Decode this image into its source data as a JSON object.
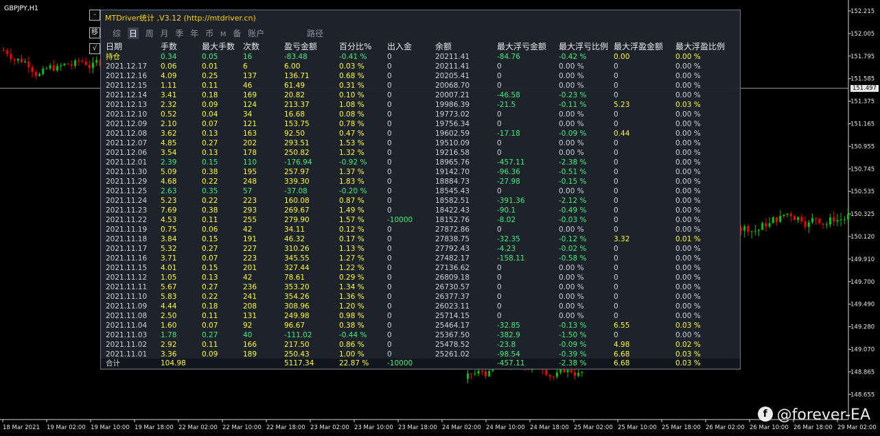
{
  "chart": {
    "symbol": "GBPJPY,H1",
    "current_price": "151.497",
    "price_ticks": [
      "152.215",
      "152.005",
      "151.795",
      "151.585",
      "151.375",
      "151.165",
      "150.955",
      "150.745",
      "150.535",
      "150.325",
      "150.120",
      "149.910",
      "149.700",
      "149.490",
      "149.280",
      "149.070",
      "148.865",
      "148.655"
    ],
    "time_ticks": [
      "18 Mar 2021",
      "19 Mar 02:00",
      "19 Mar 10:00",
      "19 Mar 18:00",
      "22 Mar 02:00",
      "22 Mar 10:00",
      "22 Mar 18:00",
      "23 Mar 02:00",
      "23 Mar 10:00",
      "23 Mar 18:00",
      "24 Mar 02:00",
      "24 Mar 10:00",
      "24 Mar 18:00",
      "25 Mar 02:00",
      "25 Mar 10:00",
      "25 Mar 18:00",
      "26 Mar 02:00",
      "26 Mar 10:00",
      "26 Mar 18:00",
      "29 Mar 02:00"
    ],
    "colors": {
      "up": "#00c800",
      "down": "#ff0000",
      "background": "#000000"
    }
  },
  "watermark": "@forever-EA",
  "side_buttons": [
    "-",
    "移",
    "√"
  ],
  "panel": {
    "title": "MTDriver统计 ,V3.12 (http://mtdriver.cn)",
    "tabs": [
      "综",
      "日",
      "周",
      "月",
      "季",
      "年",
      "币",
      "M",
      "备",
      "账户"
    ],
    "tab_path": "路径",
    "headers": [
      "日期",
      "手数",
      "最大手数",
      "次数",
      "盈亏金额",
      "百分比%",
      "出入金",
      "余额",
      "最大浮亏金额",
      "最大浮亏比例",
      "最大浮盈金额",
      "最大浮盈比例"
    ],
    "rows": [
      {
        "c": [
          "持仓",
          "0.34",
          "0.05",
          "16",
          "-83.48",
          "-0.41 %",
          "0",
          "20211.41",
          "-84.76",
          "-0.42 %",
          "0.00",
          "0.00 %"
        ],
        "color": "g"
      },
      {
        "c": [
          "2021.12.17",
          "0.06",
          "0.01",
          "6",
          "6.00",
          "0.03 %",
          "0",
          "20211.41",
          "0",
          "0.00 %",
          "0",
          "0.00 %"
        ],
        "color": "y"
      },
      {
        "c": [
          "2021.12.16",
          "4.09",
          "0.25",
          "137",
          "136.71",
          "0.68 %",
          "0",
          "20205.41",
          "0",
          "0.00 %",
          "0",
          "0.00 %"
        ],
        "color": "y"
      },
      {
        "c": [
          "2021.12.15",
          "1.11",
          "0.11",
          "46",
          "61.49",
          "0.31 %",
          "0",
          "20068.70",
          "0",
          "0.00 %",
          "0",
          "0.00 %"
        ],
        "color": "y"
      },
      {
        "c": [
          "2021.12.14",
          "3.41",
          "0.18",
          "169",
          "20.82",
          "0.10 %",
          "0",
          "20007.21",
          "-46.58",
          "-0.23 %",
          "0",
          "0.00 %"
        ],
        "color": "y"
      },
      {
        "c": [
          "2021.12.13",
          "2.32",
          "0.09",
          "124",
          "213.37",
          "1.08 %",
          "0",
          "19986.39",
          "-21.5",
          "-0.11 %",
          "5.23",
          "0.03 %"
        ],
        "color": "y"
      },
      {
        "c": [
          "2021.12.10",
          "0.52",
          "0.04",
          "34",
          "16.68",
          "0.08 %",
          "0",
          "19773.02",
          "0",
          "0.00 %",
          "0",
          "0.00 %"
        ],
        "color": "y"
      },
      {
        "c": [
          "2021.12.09",
          "2.10",
          "0.07",
          "121",
          "153.75",
          "0.78 %",
          "0",
          "19756.34",
          "0",
          "0.00 %",
          "0",
          "0.00 %"
        ],
        "color": "y"
      },
      {
        "c": [
          "2021.12.08",
          "3.62",
          "0.13",
          "163",
          "92.50",
          "0.47 %",
          "0",
          "19602.59",
          "-17.18",
          "-0.09 %",
          "0.44",
          "0.00 %"
        ],
        "color": "y"
      },
      {
        "c": [
          "2021.12.07",
          "4.85",
          "0.27",
          "202",
          "293.51",
          "1.53 %",
          "0",
          "19510.09",
          "0",
          "0.00 %",
          "0",
          "0.00 %"
        ],
        "color": "y"
      },
      {
        "c": [
          "2021.12.06",
          "3.54",
          "0.13",
          "178",
          "250.82",
          "1.32 %",
          "0",
          "19216.58",
          "0",
          "0.00 %",
          "0",
          "0.00 %"
        ],
        "color": "y"
      },
      {
        "c": [
          "2021.12.01",
          "2.39",
          "0.15",
          "110",
          "-176.94",
          "-0.92 %",
          "0",
          "18965.76",
          "-457.11",
          "-2.38 %",
          "0",
          "0.00 %"
        ],
        "color": "g"
      },
      {
        "c": [
          "2021.11.30",
          "5.09",
          "0.38",
          "195",
          "257.97",
          "1.37 %",
          "0",
          "19142.70",
          "-96.36",
          "-0.51 %",
          "0",
          "0.00 %"
        ],
        "color": "y"
      },
      {
        "c": [
          "2021.11.29",
          "4.68",
          "0.22",
          "248",
          "339.30",
          "1.83 %",
          "0",
          "18884.73",
          "-27.98",
          "-0.15 %",
          "0",
          "0.00 %"
        ],
        "color": "y"
      },
      {
        "c": [
          "2021.11.25",
          "2.63",
          "0.35",
          "57",
          "-37.08",
          "-0.20 %",
          "0",
          "18545.43",
          "0",
          "0.00 %",
          "0",
          "0.00 %"
        ],
        "color": "g"
      },
      {
        "c": [
          "2021.11.24",
          "5.23",
          "0.22",
          "223",
          "160.08",
          "0.87 %",
          "0",
          "18582.51",
          "-391.36",
          "-2.12 %",
          "0",
          "0.00 %"
        ],
        "color": "y"
      },
      {
        "c": [
          "2021.11.23",
          "7.69",
          "0.38",
          "293",
          "269.67",
          "1.49 %",
          "0",
          "18422.43",
          "-90.1",
          "-0.49 %",
          "0",
          "0.00 %"
        ],
        "color": "y"
      },
      {
        "c": [
          "2021.11.22",
          "4.53",
          "0.11",
          "255",
          "279.90",
          "1.57 %",
          "-10000",
          "18152.76",
          "-8.02",
          "-0.03 %",
          "0",
          "0.00 %"
        ],
        "color": "y"
      },
      {
        "c": [
          "2021.11.19",
          "0.75",
          "0.06",
          "42",
          "34.11",
          "0.12 %",
          "0",
          "27872.86",
          "0",
          "0.00 %",
          "0",
          "0.00 %"
        ],
        "color": "y"
      },
      {
        "c": [
          "2021.11.18",
          "3.84",
          "0.15",
          "191",
          "46.32",
          "0.17 %",
          "0",
          "27838.75",
          "-32.35",
          "-0.12 %",
          "3.32",
          "0.01 %"
        ],
        "color": "y"
      },
      {
        "c": [
          "2021.11.17",
          "5.32",
          "0.27",
          "227",
          "310.26",
          "1.13 %",
          "0",
          "27792.43",
          "-4.23",
          "-0.02 %",
          "0",
          "0.00 %"
        ],
        "color": "y"
      },
      {
        "c": [
          "2021.11.16",
          "3.71",
          "0.07",
          "223",
          "345.55",
          "1.27 %",
          "0",
          "27482.17",
          "-158.11",
          "-0.58 %",
          "0",
          "0.00 %"
        ],
        "color": "y"
      },
      {
        "c": [
          "2021.11.15",
          "4.01",
          "0.15",
          "201",
          "327.44",
          "1.22 %",
          "0",
          "27136.62",
          "0",
          "0.00 %",
          "0",
          "0.00 %"
        ],
        "color": "y"
      },
      {
        "c": [
          "2021.11.12",
          "1.05",
          "0.13",
          "42",
          "78.61",
          "0.29 %",
          "0",
          "26809.18",
          "0",
          "0.00 %",
          "0",
          "0.00 %"
        ],
        "color": "y"
      },
      {
        "c": [
          "2021.11.11",
          "5.67",
          "0.27",
          "236",
          "353.20",
          "1.34 %",
          "0",
          "26730.57",
          "0",
          "0.00 %",
          "0",
          "0.00 %"
        ],
        "color": "y"
      },
      {
        "c": [
          "2021.11.10",
          "5.83",
          "0.22",
          "241",
          "354.26",
          "1.36 %",
          "0",
          "26377.37",
          "0",
          "0.00 %",
          "0",
          "0.00 %"
        ],
        "color": "y"
      },
      {
        "c": [
          "2021.11.09",
          "4.44",
          "0.18",
          "208",
          "308.96",
          "1.20 %",
          "0",
          "26023.11",
          "0",
          "0.00 %",
          "0",
          "0.00 %"
        ],
        "color": "y"
      },
      {
        "c": [
          "2021.11.08",
          "2.50",
          "0.11",
          "131",
          "249.98",
          "0.98 %",
          "0",
          "25714.15",
          "0",
          "0.00 %",
          "0",
          "0.00 %"
        ],
        "color": "y"
      },
      {
        "c": [
          "2021.11.04",
          "1.60",
          "0.07",
          "92",
          "96.67",
          "0.38 %",
          "0",
          "25464.17",
          "-32.85",
          "-0.13 %",
          "6.55",
          "0.03 %"
        ],
        "color": "y"
      },
      {
        "c": [
          "2021.11.03",
          "1.78",
          "0.27",
          "40",
          "-111.02",
          "-0.44 %",
          "0",
          "25367.50",
          "-382.9",
          "-1.50 %",
          "0",
          "0.00 %"
        ],
        "color": "g"
      },
      {
        "c": [
          "2021.11.02",
          "2.92",
          "0.11",
          "166",
          "217.50",
          "0.86 %",
          "0",
          "25478.52",
          "-23.8",
          "-0.09 %",
          "4.98",
          "0.02 %"
        ],
        "color": "y"
      },
      {
        "c": [
          "2021.11.01",
          "3.36",
          "0.09",
          "189",
          "250.43",
          "1.00 %",
          "0",
          "25261.02",
          "-98.54",
          "-0.39 %",
          "6.68",
          "0.03 %"
        ],
        "color": "y"
      }
    ],
    "total": {
      "c": [
        "合计",
        "104.98",
        "",
        "",
        "5117.34",
        "22.87 %",
        "-10000",
        "",
        "-457.11",
        "-2.38 %",
        "6.68",
        "0.03 %"
      ]
    }
  }
}
